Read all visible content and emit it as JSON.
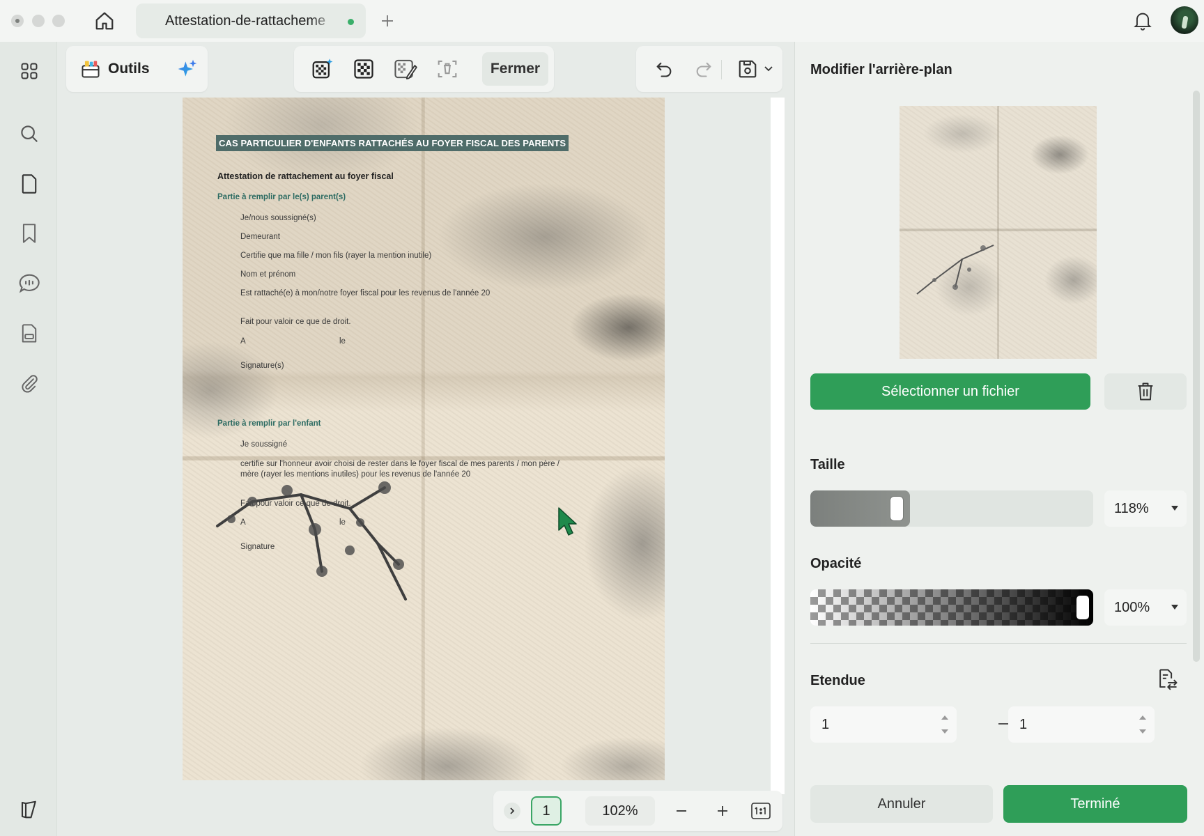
{
  "window": {
    "tab_title": "Attestation-de-rattacheme"
  },
  "toolbar": {
    "outils_label": "Outils",
    "fermer_label": "Fermer"
  },
  "document": {
    "header_band": "CAS PARTICULIER D'ENFANTS RATTACHÉS AU FOYER FISCAL DES PARENTS",
    "title": "Attestation de rattachement au foyer fiscal",
    "section1_heading": "Partie à remplir par le(s) parent(s)",
    "lines1": [
      "Je/nous soussigné(s)",
      "Demeurant",
      "Certifie que ma fille / mon fils (rayer la mention inutile)",
      "Nom et prénom",
      "Est rattaché(e) à mon/notre foyer fiscal pour les revenus de l'année 20"
    ],
    "fait1": "Fait pour valoir ce que de droit.",
    "a1": "A",
    "le1": "le",
    "signature1": "Signature(s)",
    "section2_heading": "Partie à remplir par l'enfant",
    "je_soussigne": "Je soussigné",
    "certifie_line1": "certifie sur l'honneur avoir choisi de rester dans le foyer fiscal de mes parents / mon père /",
    "certifie_line2": "mère (rayer les mentions inutiles) pour les revenus de l'année 20",
    "fait2": "Fait pour valoir ce que de droit.",
    "a2": "A",
    "le2": "le",
    "signature2": "Signature"
  },
  "pager": {
    "page": "1",
    "zoom": "102%"
  },
  "panel": {
    "title": "Modifier l'arrière-plan",
    "select_file_label": "Sélectionner un fichier",
    "size_label": "Taille",
    "size_value": "118%",
    "size_slider_fraction": 0.29,
    "opacity_label": "Opacité",
    "opacity_value": "100%",
    "opacity_slider_fraction": 1.0,
    "range_label": "Etendue",
    "range_from": "1",
    "range_to": "1",
    "cancel_label": "Annuler",
    "done_label": "Terminé"
  },
  "colors": {
    "accent": "#2f9e58",
    "header_band": "#4f6c69",
    "section_heading": "#2c6b62"
  }
}
